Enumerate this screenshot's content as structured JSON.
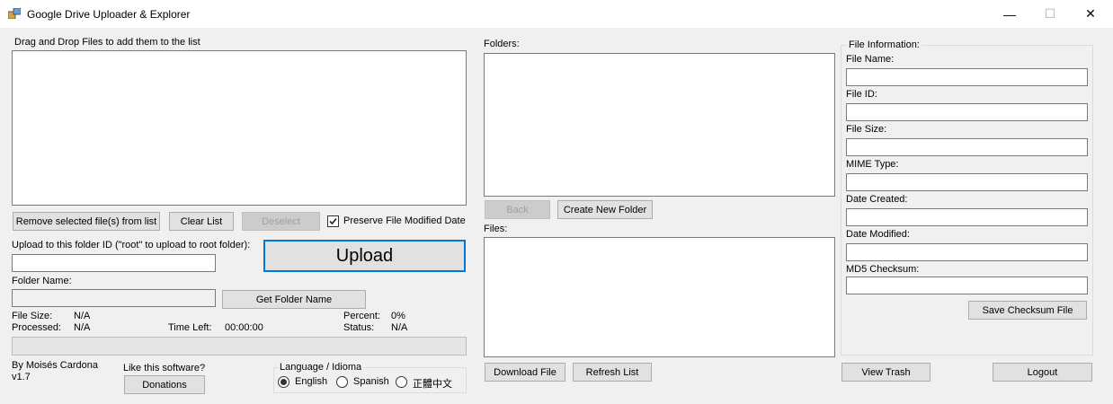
{
  "window": {
    "title": "Google Drive Uploader & Explorer",
    "minimize_glyph": "—",
    "maximize_glyph": "☐",
    "close_glyph": "✕"
  },
  "left": {
    "drop_label": "Drag and Drop Files to add them to the list",
    "remove_button": "Remove selected file(s) from list",
    "clear_button": "Clear List",
    "deselect_button": "Deselect",
    "preserve_label": "Preserve File Modified Date",
    "preserve_checked": true,
    "upload_folder_label": "Upload to this folder ID (\"root\" to upload to root folder):",
    "upload_folder_value": "",
    "upload_button": "Upload",
    "folder_name_label": "Folder Name:",
    "folder_name_value": "",
    "get_folder_button": "Get Folder Name",
    "status": {
      "file_size_label": "File Size:",
      "file_size_value": "N/A",
      "processed_label": "Processed:",
      "processed_value": "N/A",
      "time_left_label": "Time Left:",
      "time_left_value": "00:00:00",
      "percent_label": "Percent:",
      "percent_value": "0%",
      "status_label": "Status:",
      "status_value": "N/A"
    },
    "progress": 0,
    "author": "By Moisés Cardona",
    "version": "v1.7",
    "like_label": "Like this software?",
    "donations_button": "Donations",
    "language": {
      "title": "Language / Idioma",
      "options": [
        "English",
        "Spanish",
        "正體中文"
      ],
      "selected": "English"
    }
  },
  "middle": {
    "folders_label": "Folders:",
    "back_button": "Back",
    "create_folder_button": "Create New Folder",
    "files_label": "Files:",
    "download_button": "Download File",
    "refresh_button": "Refresh List"
  },
  "right": {
    "group_title": "File Information:",
    "fields": [
      {
        "label": "File Name:",
        "value": ""
      },
      {
        "label": "File ID:",
        "value": ""
      },
      {
        "label": "File Size:",
        "value": ""
      },
      {
        "label": "MIME Type:",
        "value": ""
      },
      {
        "label": "Date Created:",
        "value": ""
      },
      {
        "label": "Date Modified:",
        "value": ""
      },
      {
        "label": "MD5 Checksum:",
        "value": ""
      }
    ],
    "save_checksum_button": "Save Checksum File",
    "view_trash_button": "View Trash",
    "logout_button": "Logout"
  }
}
